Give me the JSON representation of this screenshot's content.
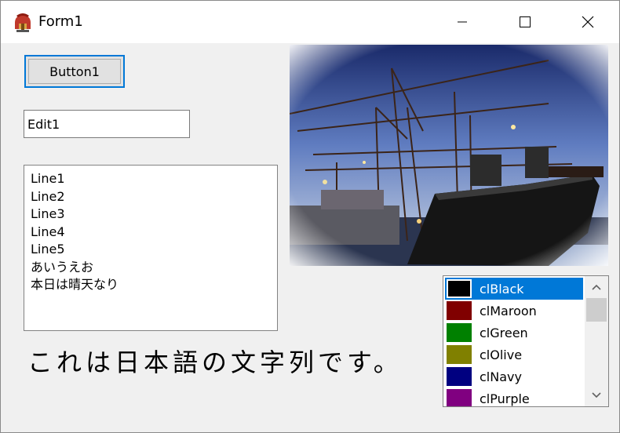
{
  "window": {
    "title": "Form1",
    "icon": "spartan-helmet-icon"
  },
  "titlebar_controls": {
    "minimize": "minimize-icon",
    "maximize": "maximize-icon",
    "close": "close-icon"
  },
  "button1": {
    "label": "Button1"
  },
  "edit1": {
    "value": "Edit1"
  },
  "memo": {
    "lines": [
      "Line1",
      "Line2",
      "Line3",
      "Line4",
      "Line5",
      "あいうえお",
      "本日は晴天なり"
    ]
  },
  "japanese_label": "これは日本語の文字列です。",
  "colors": {
    "selected": "clBlack",
    "items": [
      {
        "name": "clBlack",
        "color": "#000000"
      },
      {
        "name": "clMaroon",
        "color": "#800000"
      },
      {
        "name": "clGreen",
        "color": "#008000"
      },
      {
        "name": "clOlive",
        "color": "#808000"
      },
      {
        "name": "clNavy",
        "color": "#000080"
      },
      {
        "name": "clPurple",
        "color": "#800080"
      }
    ]
  },
  "accent": "#0078d7"
}
